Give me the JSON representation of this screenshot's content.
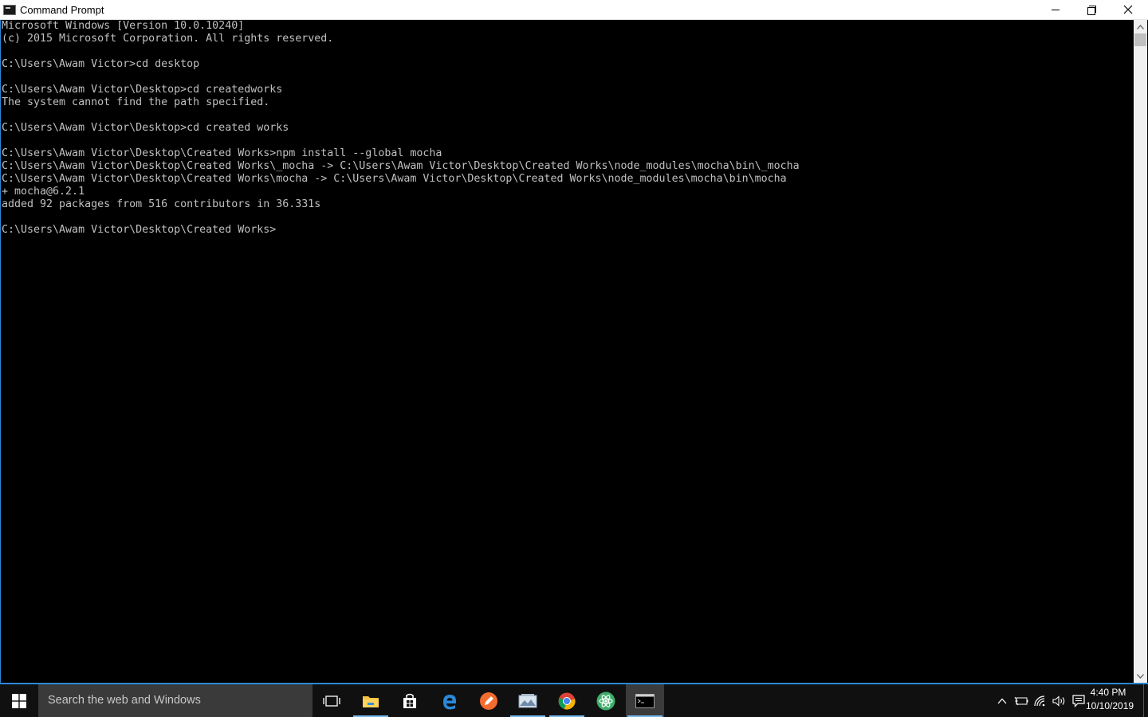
{
  "window": {
    "title": "Command Prompt"
  },
  "console": {
    "lines": [
      "Microsoft Windows [Version 10.0.10240]",
      "(c) 2015 Microsoft Corporation. All rights reserved.",
      "",
      "C:\\Users\\Awam Victor>cd desktop",
      "",
      "C:\\Users\\Awam Victor\\Desktop>cd createdworks",
      "The system cannot find the path specified.",
      "",
      "C:\\Users\\Awam Victor\\Desktop>cd created works",
      "",
      "C:\\Users\\Awam Victor\\Desktop\\Created Works>npm install --global mocha",
      "C:\\Users\\Awam Victor\\Desktop\\Created Works\\_mocha -> C:\\Users\\Awam Victor\\Desktop\\Created Works\\node_modules\\mocha\\bin\\_mocha",
      "C:\\Users\\Awam Victor\\Desktop\\Created Works\\mocha -> C:\\Users\\Awam Victor\\Desktop\\Created Works\\node_modules\\mocha\\bin\\mocha",
      "+ mocha@6.2.1",
      "added 92 packages from 516 contributors in 36.331s",
      "",
      "C:\\Users\\Awam Victor\\Desktop\\Created Works>"
    ]
  },
  "taskbar": {
    "search_placeholder": "Search the web and Windows",
    "apps": [
      "task-view",
      "file-explorer",
      "store",
      "edge",
      "app-orange",
      "app-photos",
      "chrome",
      "atom",
      "command-prompt"
    ],
    "clock": {
      "time": "4:40 PM",
      "date": "10/10/2019"
    }
  },
  "colors": {
    "console_bg": "#000000",
    "console_text": "#c0c0c0",
    "accent": "#2b88d8",
    "taskbar_bg": "#101010"
  }
}
